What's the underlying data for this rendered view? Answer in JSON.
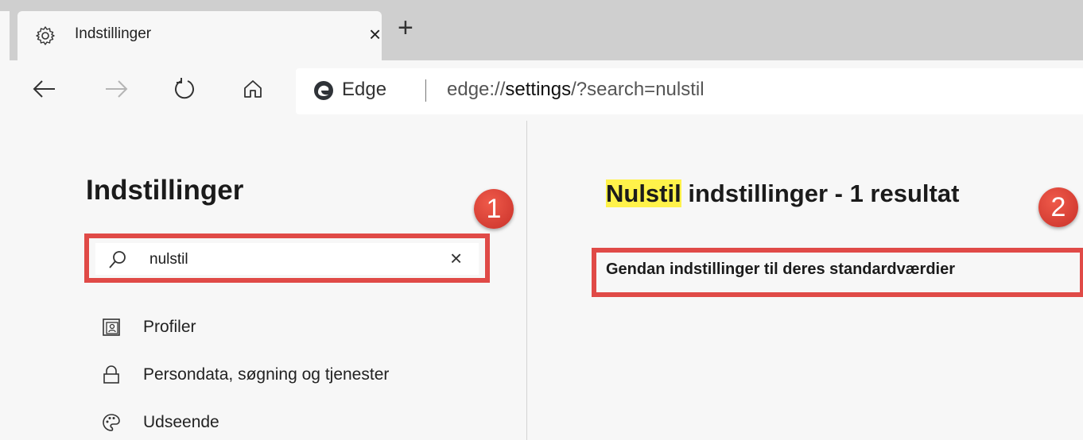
{
  "tab": {
    "title": "Indstillinger",
    "close": "×",
    "new_tab": "+"
  },
  "icons": {
    "tab": "gear-icon",
    "back": "arrow-left-icon",
    "forward": "arrow-right-icon",
    "refresh": "refresh-icon",
    "home": "home-icon",
    "edge": "edge-logo-icon",
    "search": "search-icon",
    "profiles": "profile-icon",
    "privacy": "lock-icon",
    "appearance": "palette-icon"
  },
  "address_bar": {
    "site_name": "Edge",
    "url_prefix": "edge://",
    "url_host": "settings",
    "url_suffix": "/?search=nulstil"
  },
  "sidebar": {
    "heading": "Indstillinger",
    "search": {
      "value": "nulstil",
      "clear": "×"
    },
    "items": [
      {
        "label": "Profiler"
      },
      {
        "label": "Persondata, søgning og tjenester"
      },
      {
        "label": "Udseende"
      }
    ]
  },
  "main": {
    "results_highlight": "Nulstil",
    "results_rest": " indstillinger - 1 resultat",
    "result_link": "Gendan indstillinger til deres standardværdier"
  },
  "annotations": {
    "badge1": "1",
    "badge2": "2"
  },
  "colors": {
    "accent_red": "#e04a47",
    "highlight": "#fff24a",
    "background": "#f7f7f7"
  }
}
